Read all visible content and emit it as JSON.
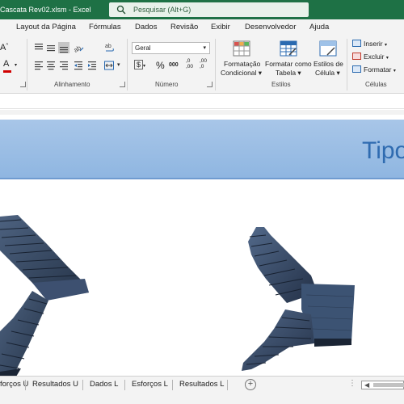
{
  "titlebar": {
    "filename": "Cascata Rev02.xlsm  -  Excel",
    "search_placeholder": "Pesquisar (Alt+G)"
  },
  "ribbon_tabs": [
    {
      "label": "Layout da Página"
    },
    {
      "label": "Fórmulas"
    },
    {
      "label": "Dados"
    },
    {
      "label": "Revisão"
    },
    {
      "label": "Exibir"
    },
    {
      "label": "Desenvolvedor"
    },
    {
      "label": "Ajuda"
    }
  ],
  "ribbon": {
    "font_grow": "A",
    "font_color_letter": "A",
    "group_alignment": "Alinhamento",
    "number_format": "Geral",
    "currency_symbol": "$",
    "percent_symbol": "%",
    "thousands_symbol": "000",
    "decrease_decimal": ",00",
    "increase_decimal": ",0",
    "group_number": "Número",
    "cond_format_line1": "Formatação",
    "cond_format_line2": "Condicional",
    "table_format_line1": "Formatar como",
    "table_format_line2": "Tabela",
    "cell_styles_line1": "Estilos de",
    "cell_styles_line2": "Célula",
    "group_styles": "Estilos",
    "insert": "Inserir",
    "delete": "Excluir",
    "format": "Formatar",
    "group_cells": "Células"
  },
  "sheet": {
    "banner_title": "Tipo"
  },
  "sheet_tabs": [
    {
      "label": "forços U"
    },
    {
      "label": "Resultados U"
    },
    {
      "label": "Dados L"
    },
    {
      "label": "Esforços L"
    },
    {
      "label": "Resultados L"
    }
  ],
  "icons": {
    "search": "search-icon",
    "add_sheet": "plus-circle-icon",
    "scroll_left": "chevron-left-icon"
  },
  "colors": {
    "excel_green": "#1e7145",
    "banner_blue": "#9bbfe6",
    "banner_text": "#2f6bb0",
    "stair_dark": "#2e3f57"
  }
}
